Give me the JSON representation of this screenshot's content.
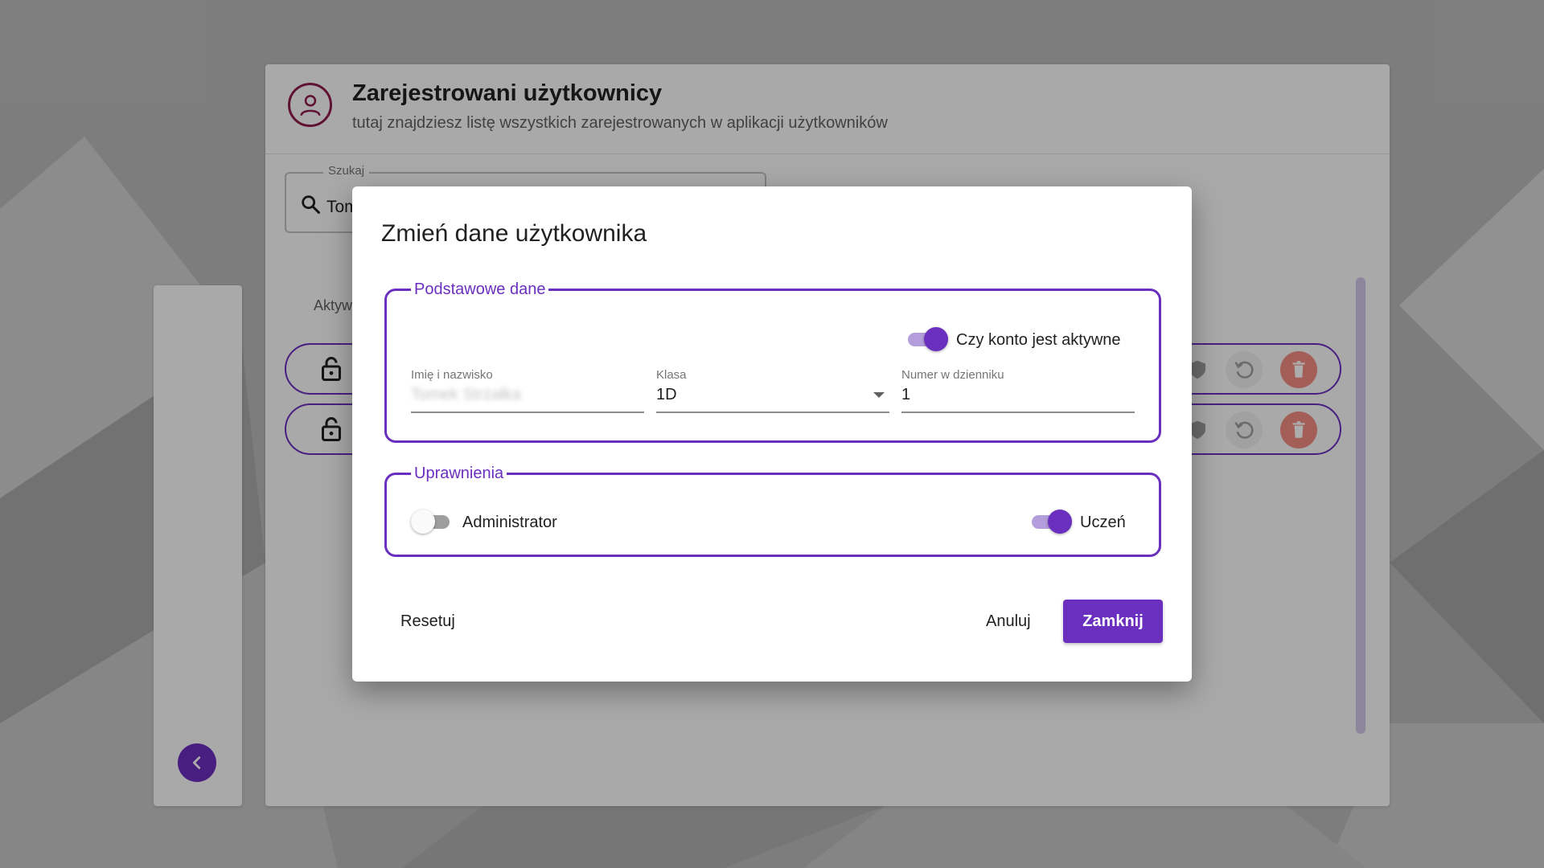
{
  "page": {
    "title": "Zarejestrowani użytkownicy",
    "subtitle": "tutaj znajdziesz listę wszystkich zarejestrowanych w aplikacji użytkowników"
  },
  "search": {
    "label": "Szukaj",
    "value": "Tom"
  },
  "table": {
    "column_label": "Aktyw"
  },
  "colors": {
    "accent": "#6a2fbf",
    "accent_light": "#b39ddb",
    "title_icon": "#8e1b4a",
    "delete": "#f28b82"
  },
  "icons": {
    "header": "account-circle-icon",
    "search": "search-icon",
    "row_lock": "lock-open-icon",
    "row_shield": "shield-icon",
    "row_reset": "reset-icon",
    "row_delete": "delete-icon",
    "side_collapse": "chevron-left-icon"
  },
  "dialog": {
    "title": "Zmień dane użytkownika",
    "basic": {
      "legend": "Podstawowe dane",
      "active_toggle": {
        "label": "Czy konto jest aktywne",
        "checked": true
      },
      "name_field": {
        "label": "Imię i nazwisko",
        "value": "Tomek Strzałka"
      },
      "class_field": {
        "label": "Klasa",
        "value": "1D"
      },
      "number_field": {
        "label": "Numer w dzienniku",
        "value": "1"
      }
    },
    "permissions": {
      "legend": "Uprawnienia",
      "admin_toggle": {
        "label": "Administrator",
        "checked": false
      },
      "student_toggle": {
        "label": "Uczeń",
        "checked": true
      }
    },
    "actions": {
      "reset_label": "Resetuj",
      "cancel_label": "Anuluj",
      "close_label": "Zamknij"
    }
  }
}
